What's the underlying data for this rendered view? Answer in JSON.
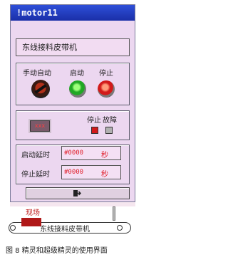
{
  "window": {
    "title": "!motor11",
    "device_name": "东线接料皮带机"
  },
  "control_panel": {
    "mode_label": "手动自动",
    "start_label": "启动",
    "stop_label": "停止"
  },
  "status_panel": {
    "display_value": "xxx",
    "stop_label": "停止",
    "fault_label": "故障"
  },
  "start_delay": {
    "label": "启动延时",
    "value": "#0000",
    "unit": "秒"
  },
  "stop_delay": {
    "label": "停止延时",
    "value": "#0000",
    "unit": "秒"
  },
  "background": {
    "label_top": "现场",
    "conveyor_label": "东线接料皮带机"
  },
  "caption": "图 8   精灵和超级精灵的使用界面",
  "colors": {
    "titlebar": "#2e4fd8",
    "window_bg": "#ecd7f0",
    "value_red": "#e0202a"
  }
}
